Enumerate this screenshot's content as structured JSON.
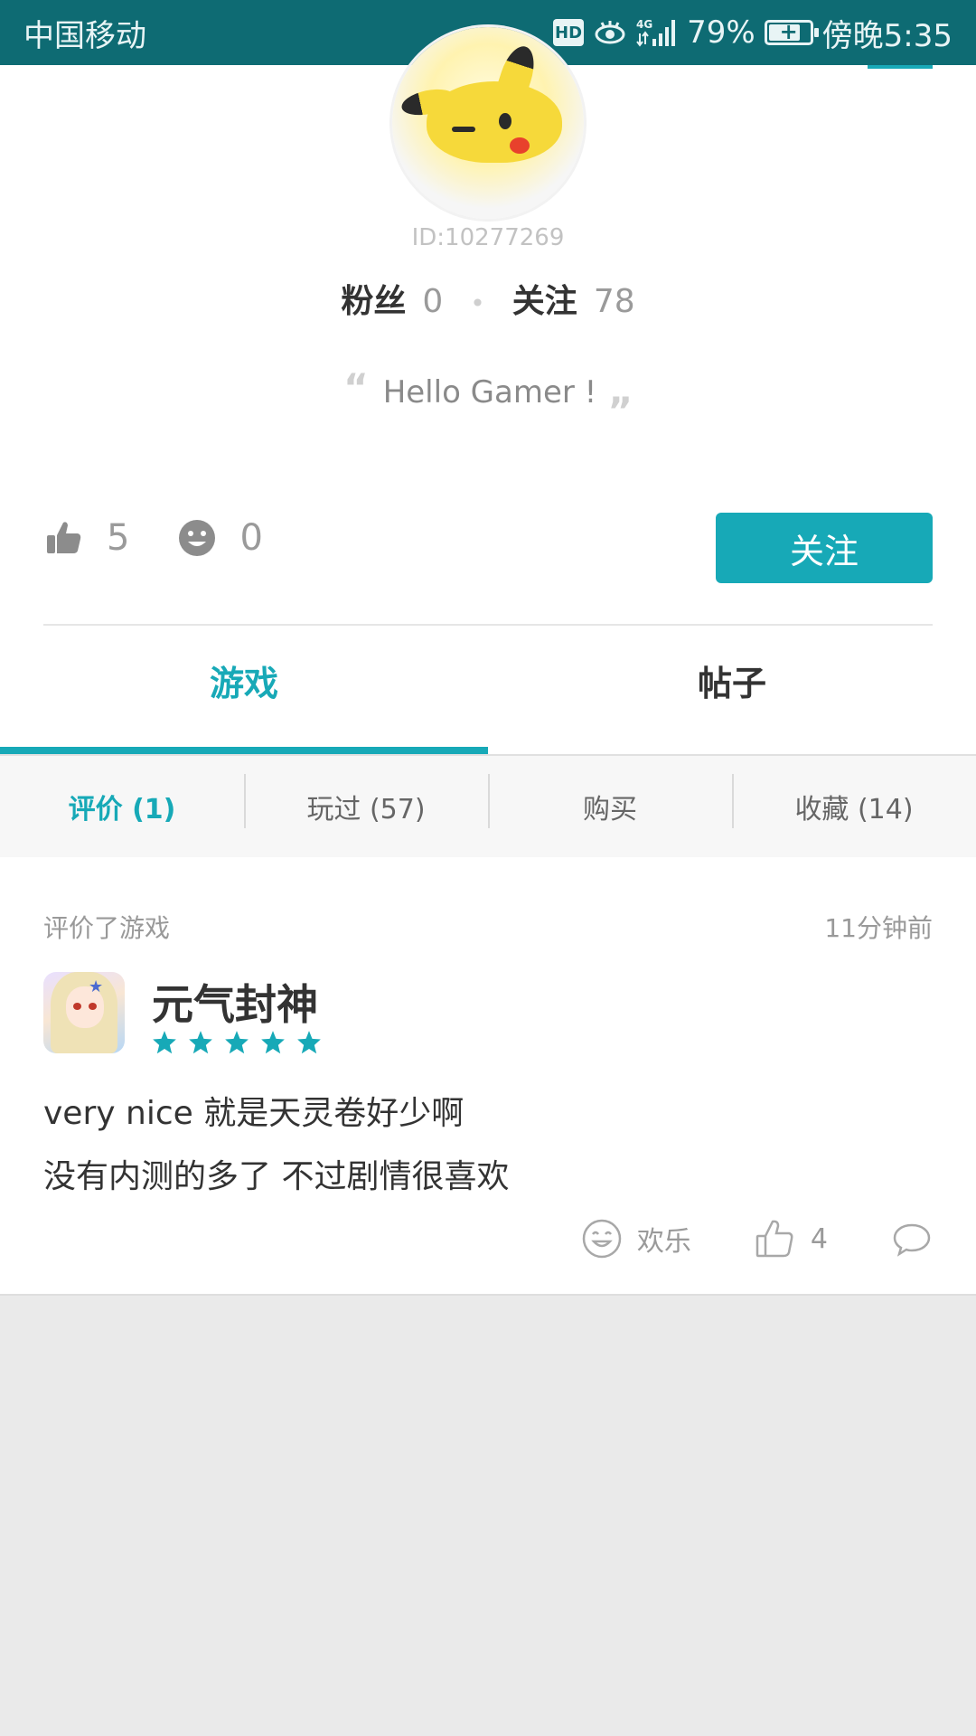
{
  "status_bar": {
    "carrier": "中国移动",
    "hd": "HD",
    "network": "4G",
    "battery_percent": "79%",
    "battery_level": 0.79,
    "time": "傍晚5:35"
  },
  "profile": {
    "user_id": "ID:10277269",
    "followers_label": "粉丝",
    "followers_count": "0",
    "following_label": "关注",
    "following_count": "78",
    "motto": "Hello Gamer !",
    "likes_count": "5",
    "smiles_count": "0",
    "follow_button": "关注"
  },
  "tabs": [
    {
      "label": "游戏",
      "active": true
    },
    {
      "label": "帖子",
      "active": false
    }
  ],
  "subtabs": [
    {
      "label": "评价 (1)",
      "active": true
    },
    {
      "label": "玩过 (57)",
      "active": false
    },
    {
      "label": "购买",
      "active": false
    },
    {
      "label": "收藏 (14)",
      "active": false
    }
  ],
  "review": {
    "action_label": "评价了游戏",
    "time": "11分钟前",
    "game_name": "元气封神",
    "rating": 5,
    "text_lines": [
      "very nice 就是天灵卷好少啊",
      "没有内测的多了 不过剧情很喜欢"
    ],
    "funny_label": "欢乐",
    "like_count": "4"
  },
  "colors": {
    "accent": "#17a9b7",
    "status_bar": "#0e6b73"
  }
}
